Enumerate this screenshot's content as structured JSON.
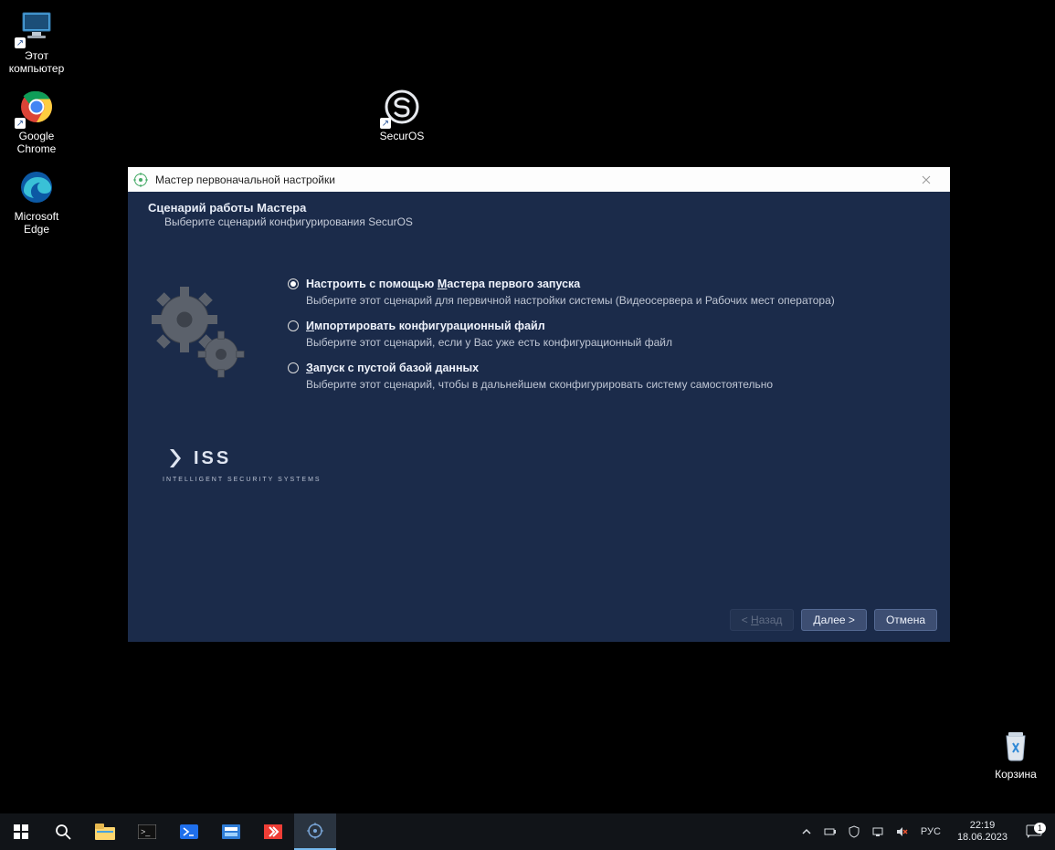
{
  "desktop": {
    "icons": {
      "this_pc": "Этот\nкомпьютер",
      "chrome": "Google\nChrome",
      "edge": "Microsoft\nEdge",
      "securos": "SecurOS",
      "recycle": "Корзина"
    }
  },
  "wizard": {
    "title": "Мастер первоначальной настройки",
    "header": "Сценарий работы Мастера",
    "subheader": "Выберите сценарий конфигурирования SecurOS",
    "options": [
      {
        "selected": true,
        "pre": "Настроить с помощью ",
        "ul": "М",
        "post": "астера первого запуска",
        "desc": "Выберите этот сценарий для первичной настройки системы (Видеосервера и Рабочих мест оператора)"
      },
      {
        "selected": false,
        "pre": "",
        "ul": "И",
        "post": "мпортировать конфигурационный файл",
        "desc": "Выберите этот сценарий, если у Вас уже есть конфигурационный файл"
      },
      {
        "selected": false,
        "pre": "",
        "ul": "З",
        "post": "апуск с пустой базой данных",
        "desc": "Выберите этот сценарий, чтобы в дальнейшем сконфигурировать систему самостоятельно"
      }
    ],
    "logo": {
      "brand": "ISS",
      "sub": "INTELLIGENT SECURITY SYSTEMS"
    },
    "buttons": {
      "back_pre": "< ",
      "back_ul": "Н",
      "back_post": "азад",
      "next_ul": "Д",
      "next_post": "алее >",
      "cancel": "Отмена"
    }
  },
  "taskbar": {
    "lang": "РУС",
    "time": "22:19",
    "date": "18.06.2023",
    "notif_count": "1"
  }
}
